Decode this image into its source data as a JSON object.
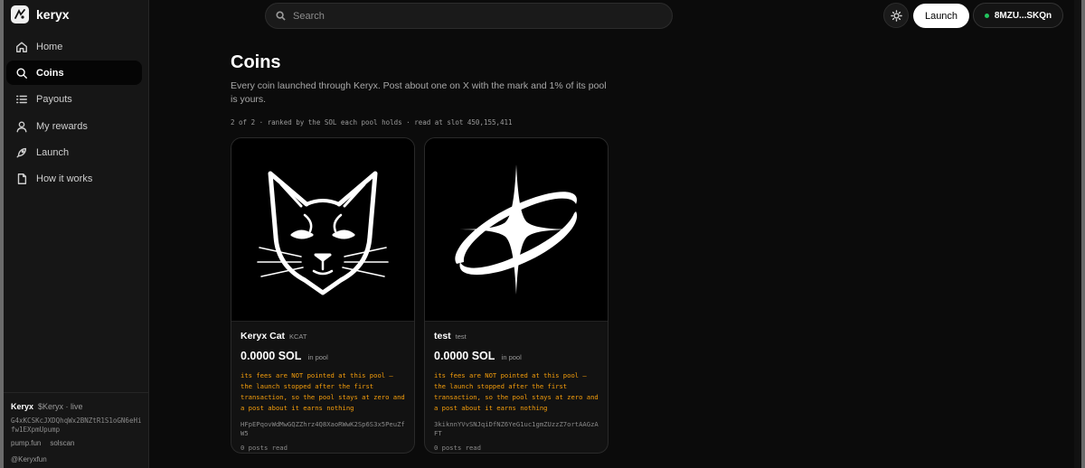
{
  "brand": {
    "name": "keryx",
    "logo_icon": "keryx-logo-icon"
  },
  "sidebar": {
    "items": [
      {
        "label": "Home",
        "icon": "home-icon",
        "active": false
      },
      {
        "label": "Coins",
        "icon": "search-icon",
        "active": true
      },
      {
        "label": "Payouts",
        "icon": "list-icon",
        "active": false
      },
      {
        "label": "My rewards",
        "icon": "user-icon",
        "active": false
      },
      {
        "label": "Launch",
        "icon": "rocket-icon",
        "active": false
      },
      {
        "label": "How it works",
        "icon": "document-icon",
        "active": false
      }
    ],
    "footer": {
      "name": "Keryx",
      "ticker_status": "$Keryx · live",
      "contract": "G4xKCSKcJXDQhqWx2BNZtR1S1oGN6eHifw1EXpmUpump",
      "links": [
        "pump.fun",
        "solscan"
      ],
      "handle": "@Keryxfun"
    }
  },
  "header": {
    "search_placeholder": "Search",
    "launch_label": "Launch",
    "wallet_label": "8MZU...SKQn",
    "theme_icon": "sun-icon",
    "colors": {
      "accent": "#ffffff",
      "wallet_dot": "#22c55e",
      "warning": "#f59e0b"
    }
  },
  "main": {
    "title": "Coins",
    "subtitle": "Every coin launched through Keryx. Post about one on X with the mark and 1% of its pool is yours.",
    "meta": "2 of 2 · ranked by the SOL each pool holds · read at slot 450,155,411",
    "coins": [
      {
        "name": "Keryx Cat",
        "ticker": "KCAT",
        "value": "0.0000 SOL",
        "pool_label": "in pool",
        "image": "cat-logo-icon",
        "warning": "its fees are NOT pointed at this pool — the launch stopped after the first transaction, so the pool stays at zero and a post about it earns nothing",
        "contract": "HFpEPqovWdMwGQZZhrz4Q8XaoRWwK2Sp6S3x5PeuZfW5",
        "posts": "0 posts read"
      },
      {
        "name": "test",
        "ticker": "test",
        "value": "0.0000 SOL",
        "pool_label": "in pool",
        "image": "star-orbit-icon",
        "warning": "its fees are NOT pointed at this pool — the launch stopped after the first transaction, so the pool stays at zero and a post about it earns nothing",
        "contract": "3kiknnYVvSNJqiDfNZ6YeG1uc1gmZUzzZ7ortAAGzAFT",
        "posts": "0 posts read"
      }
    ]
  }
}
